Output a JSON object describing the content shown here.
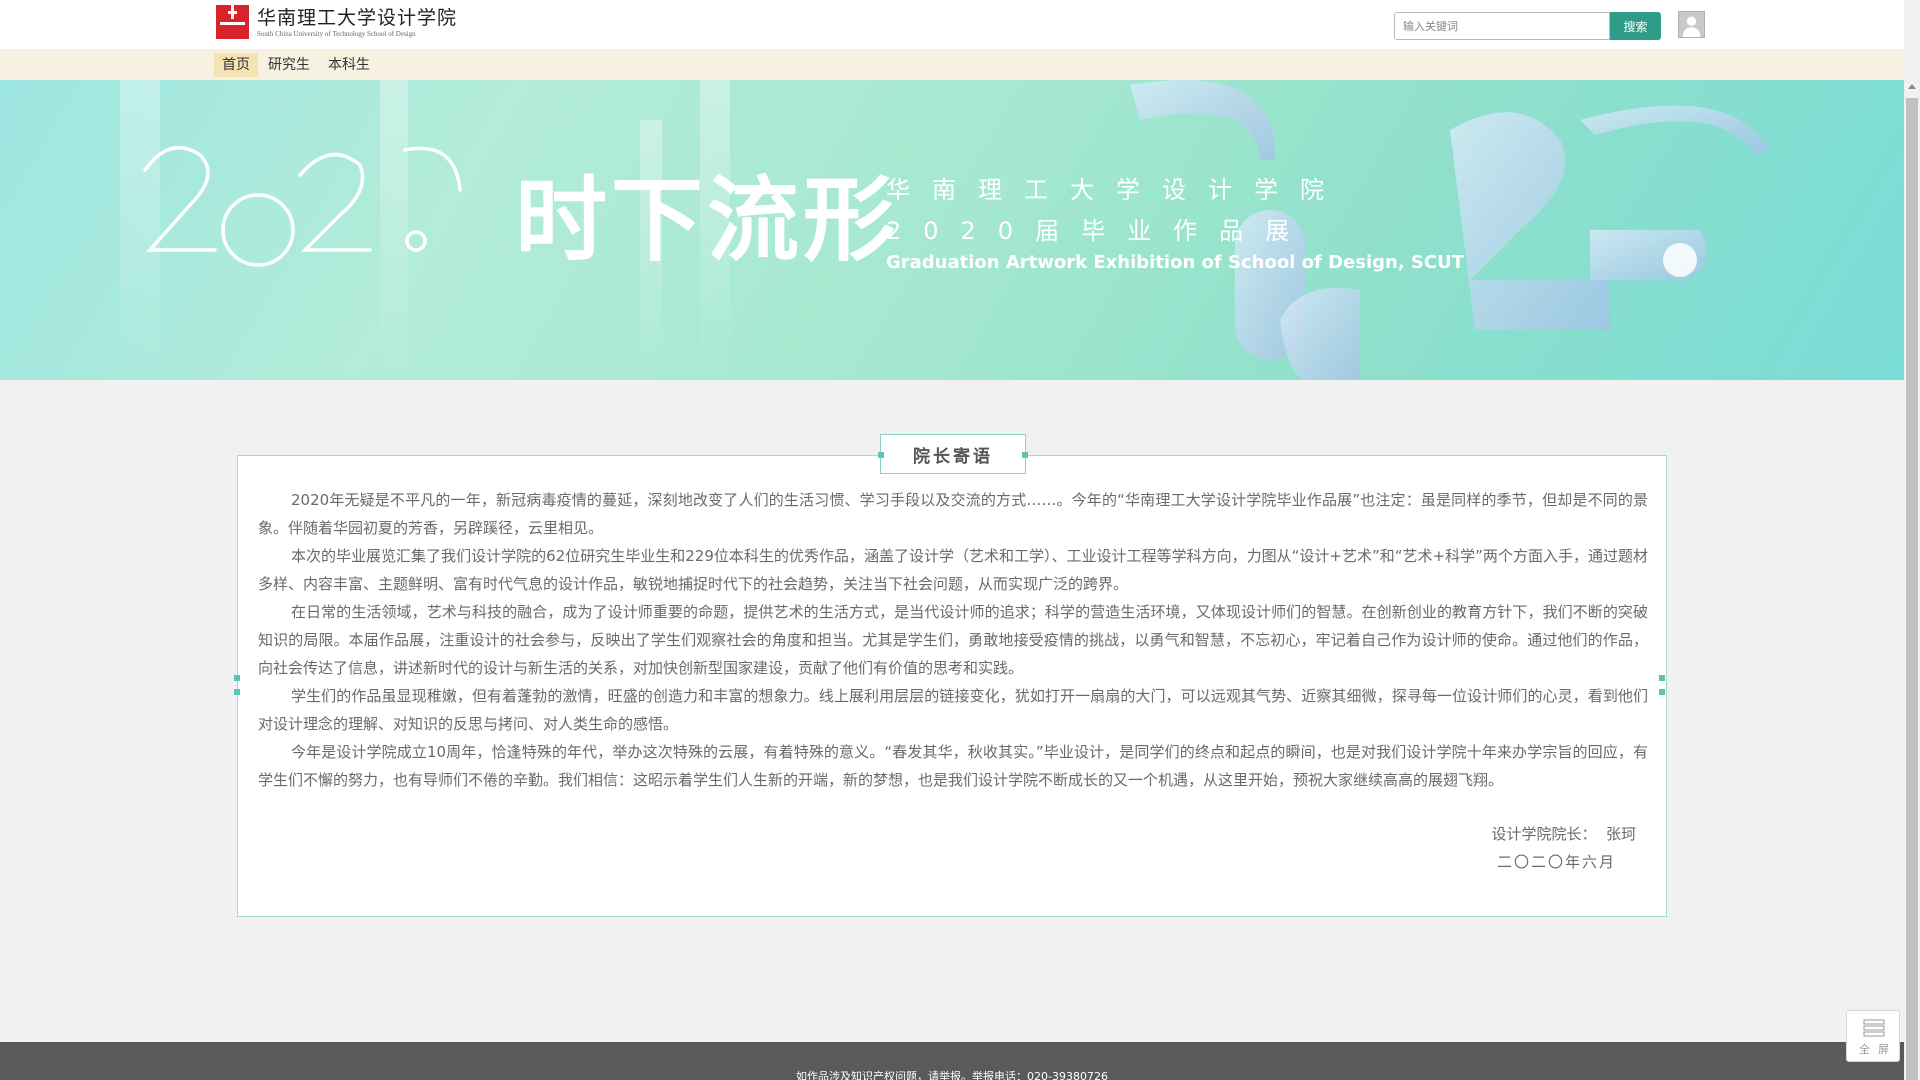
{
  "header": {
    "logo_cn": "华南理工大学设计学院",
    "logo_en": "South China University of Technology School of Design",
    "search_placeholder": "输入关键词",
    "search_button": "搜索"
  },
  "nav": {
    "items": [
      {
        "label": "首页",
        "active": true
      },
      {
        "label": "研究生",
        "active": false
      },
      {
        "label": "本科生",
        "active": false
      }
    ]
  },
  "banner": {
    "year_art": "2020",
    "title": "时下流形",
    "subtitle_line1": "华南理工大学设计学院",
    "subtitle_line2": "2020届毕业作品展",
    "subtitle_en": "Graduation Artwork Exhibition of School of Design, SCUT"
  },
  "message": {
    "title": "院长寄语",
    "paragraphs": [
      "2020年无疑是不平凡的一年，新冠病毒疫情的蔓延，深刻地改变了人们的生活习惯、学习手段以及交流的方式……。今年的“华南理工大学设计学院毕业作品展”也注定：虽是同样的季节，但却是不同的景象。伴随着华园初夏的芳香，另辟蹊径，云里相见。",
      "本次的毕业展览汇集了我们设计学院的62位研究生毕业生和229位本科生的优秀作品，涵盖了设计学（艺术和工学）、工业设计工程等学科方向，力图从“设计+艺术”和“艺术+科学”两个方面入手，通过题材多样、内容丰富、主题鲜明、富有时代气息的设计作品，敏锐地捕捉时代下的社会趋势，关注当下社会问题，从而实现广泛的跨界。",
      "在日常的生活领域，艺术与科技的融合，成为了设计师重要的命题，提供艺术的生活方式，是当代设计师的追求；科学的营造生活环境，又体现设计师们的智慧。在创新创业的教育方针下，我们不断的突破知识的局限。本届作品展，注重设计的社会参与，反映出了学生们观察社会的角度和担当。尤其是学生们，勇敢地接受疫情的挑战，以勇气和智慧，不忘初心，牢记着自己作为设计师的使命。通过他们的作品，向社会传达了信息，讲述新时代的设计与新生活的关系，对加快创新型国家建设，贡献了他们有价值的思考和实践。",
      "学生们的作品虽显现稚嫩，但有着蓬勃的激情，旺盛的创造力和丰富的想象力。线上展利用层层的链接变化，犹如打开一扇扇的大门，可以远观其气势、近察其细微，探寻每一位设计师们的心灵，看到他们对设计理念的理解、对知识的反思与拷问、对人类生命的感悟。",
      "今年是设计学院成立10周年，恰逢特殊的年代，举办这次特殊的云展，有着特殊的意义。“春发其华，秋收其实。”毕业设计，是同学们的终点和起点的瞬间，也是对我们设计学院十年来办学宗旨的回应，有学生们不懈的努力，也有导师们不倦的辛勤。我们相信：这昭示着学生们人生新的开端，新的梦想，也是我们设计学院不断成长的又一个机遇，从这里开始，预祝大家继续高高的展翅飞翔。"
    ],
    "signature": "设计学院院长：  张珂",
    "date": "二〇二〇年六月"
  },
  "footer": {
    "text": "如作品涉及知识产权问题，请举报。举报电话：020-39380726"
  },
  "widget": {
    "fullscreen_label": "全屏"
  },
  "colors": {
    "accent": "#2f9c8a",
    "nav_bg": "#f7f1e2",
    "nav_active": "#f6e3b4",
    "logo_red": "#d8232a",
    "footer_bg": "#5a5a5a"
  }
}
